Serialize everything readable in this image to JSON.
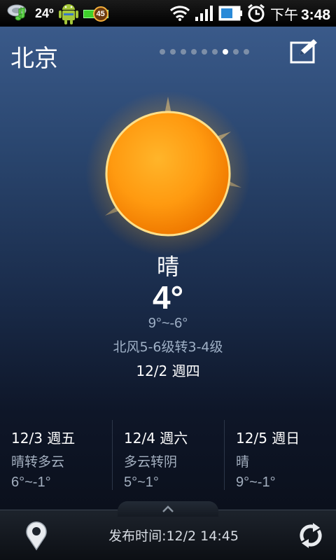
{
  "status_bar": {
    "temperature": "24º",
    "battery_level": "45",
    "time_period": "下午",
    "time": "3:48"
  },
  "header": {
    "city": "北京",
    "page_count": 9,
    "active_page": 6
  },
  "current": {
    "condition": "晴",
    "temperature": "4°",
    "range": "9°~-6°",
    "wind": "北风5-6级转3-4级",
    "date": "12/2 週四"
  },
  "forecast": [
    {
      "date": "12/3 週五",
      "condition": "晴转多云",
      "range": "6°~-1°"
    },
    {
      "date": "12/4 週六",
      "condition": "多云转阴",
      "range": "5°~1°"
    },
    {
      "date": "12/5 週日",
      "condition": "晴",
      "range": "9°~-1°"
    }
  ],
  "footer": {
    "publish_time": "发布时间:12/2 14:45"
  },
  "icons": {
    "weather": "sun-icon",
    "edit": "edit-icon",
    "location": "location-pin-icon",
    "refresh": "refresh-icon",
    "expand": "chevron-up-icon"
  },
  "colors": {
    "sun": "#ff9a10",
    "text_secondary": "#9fb0c6"
  }
}
